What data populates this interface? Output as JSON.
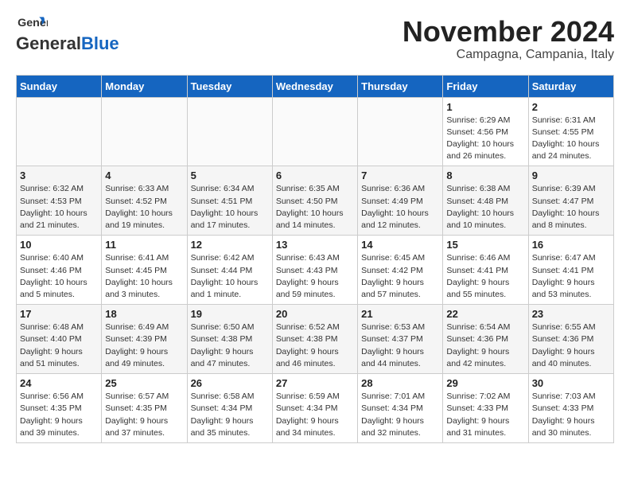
{
  "header": {
    "logo_general": "General",
    "logo_blue": "Blue",
    "month": "November 2024",
    "location": "Campagna, Campania, Italy"
  },
  "weekdays": [
    "Sunday",
    "Monday",
    "Tuesday",
    "Wednesday",
    "Thursday",
    "Friday",
    "Saturday"
  ],
  "weeks": [
    [
      {
        "day": "",
        "info": ""
      },
      {
        "day": "",
        "info": ""
      },
      {
        "day": "",
        "info": ""
      },
      {
        "day": "",
        "info": ""
      },
      {
        "day": "",
        "info": ""
      },
      {
        "day": "1",
        "info": "Sunrise: 6:29 AM\nSunset: 4:56 PM\nDaylight: 10 hours\nand 26 minutes."
      },
      {
        "day": "2",
        "info": "Sunrise: 6:31 AM\nSunset: 4:55 PM\nDaylight: 10 hours\nand 24 minutes."
      }
    ],
    [
      {
        "day": "3",
        "info": "Sunrise: 6:32 AM\nSunset: 4:53 PM\nDaylight: 10 hours\nand 21 minutes."
      },
      {
        "day": "4",
        "info": "Sunrise: 6:33 AM\nSunset: 4:52 PM\nDaylight: 10 hours\nand 19 minutes."
      },
      {
        "day": "5",
        "info": "Sunrise: 6:34 AM\nSunset: 4:51 PM\nDaylight: 10 hours\nand 17 minutes."
      },
      {
        "day": "6",
        "info": "Sunrise: 6:35 AM\nSunset: 4:50 PM\nDaylight: 10 hours\nand 14 minutes."
      },
      {
        "day": "7",
        "info": "Sunrise: 6:36 AM\nSunset: 4:49 PM\nDaylight: 10 hours\nand 12 minutes."
      },
      {
        "day": "8",
        "info": "Sunrise: 6:38 AM\nSunset: 4:48 PM\nDaylight: 10 hours\nand 10 minutes."
      },
      {
        "day": "9",
        "info": "Sunrise: 6:39 AM\nSunset: 4:47 PM\nDaylight: 10 hours\nand 8 minutes."
      }
    ],
    [
      {
        "day": "10",
        "info": "Sunrise: 6:40 AM\nSunset: 4:46 PM\nDaylight: 10 hours\nand 5 minutes."
      },
      {
        "day": "11",
        "info": "Sunrise: 6:41 AM\nSunset: 4:45 PM\nDaylight: 10 hours\nand 3 minutes."
      },
      {
        "day": "12",
        "info": "Sunrise: 6:42 AM\nSunset: 4:44 PM\nDaylight: 10 hours\nand 1 minute."
      },
      {
        "day": "13",
        "info": "Sunrise: 6:43 AM\nSunset: 4:43 PM\nDaylight: 9 hours\nand 59 minutes."
      },
      {
        "day": "14",
        "info": "Sunrise: 6:45 AM\nSunset: 4:42 PM\nDaylight: 9 hours\nand 57 minutes."
      },
      {
        "day": "15",
        "info": "Sunrise: 6:46 AM\nSunset: 4:41 PM\nDaylight: 9 hours\nand 55 minutes."
      },
      {
        "day": "16",
        "info": "Sunrise: 6:47 AM\nSunset: 4:41 PM\nDaylight: 9 hours\nand 53 minutes."
      }
    ],
    [
      {
        "day": "17",
        "info": "Sunrise: 6:48 AM\nSunset: 4:40 PM\nDaylight: 9 hours\nand 51 minutes."
      },
      {
        "day": "18",
        "info": "Sunrise: 6:49 AM\nSunset: 4:39 PM\nDaylight: 9 hours\nand 49 minutes."
      },
      {
        "day": "19",
        "info": "Sunrise: 6:50 AM\nSunset: 4:38 PM\nDaylight: 9 hours\nand 47 minutes."
      },
      {
        "day": "20",
        "info": "Sunrise: 6:52 AM\nSunset: 4:38 PM\nDaylight: 9 hours\nand 46 minutes."
      },
      {
        "day": "21",
        "info": "Sunrise: 6:53 AM\nSunset: 4:37 PM\nDaylight: 9 hours\nand 44 minutes."
      },
      {
        "day": "22",
        "info": "Sunrise: 6:54 AM\nSunset: 4:36 PM\nDaylight: 9 hours\nand 42 minutes."
      },
      {
        "day": "23",
        "info": "Sunrise: 6:55 AM\nSunset: 4:36 PM\nDaylight: 9 hours\nand 40 minutes."
      }
    ],
    [
      {
        "day": "24",
        "info": "Sunrise: 6:56 AM\nSunset: 4:35 PM\nDaylight: 9 hours\nand 39 minutes."
      },
      {
        "day": "25",
        "info": "Sunrise: 6:57 AM\nSunset: 4:35 PM\nDaylight: 9 hours\nand 37 minutes."
      },
      {
        "day": "26",
        "info": "Sunrise: 6:58 AM\nSunset: 4:34 PM\nDaylight: 9 hours\nand 35 minutes."
      },
      {
        "day": "27",
        "info": "Sunrise: 6:59 AM\nSunset: 4:34 PM\nDaylight: 9 hours\nand 34 minutes."
      },
      {
        "day": "28",
        "info": "Sunrise: 7:01 AM\nSunset: 4:34 PM\nDaylight: 9 hours\nand 32 minutes."
      },
      {
        "day": "29",
        "info": "Sunrise: 7:02 AM\nSunset: 4:33 PM\nDaylight: 9 hours\nand 31 minutes."
      },
      {
        "day": "30",
        "info": "Sunrise: 7:03 AM\nSunset: 4:33 PM\nDaylight: 9 hours\nand 30 minutes."
      }
    ]
  ]
}
